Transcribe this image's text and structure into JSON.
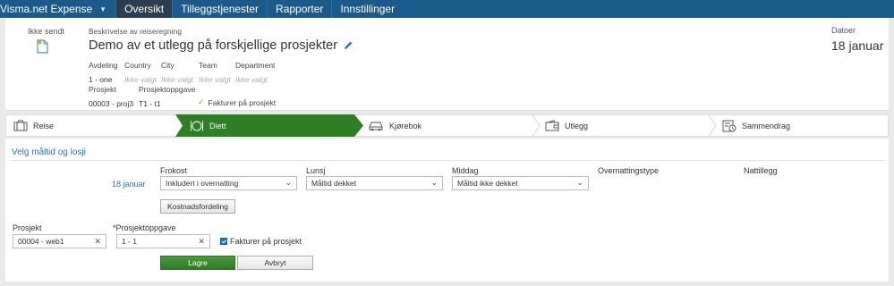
{
  "nav": {
    "brand": "Visma.net Expense",
    "tabs": [
      "Oversikt",
      "Tilleggstjenester",
      "Rapporter",
      "Innstillinger"
    ]
  },
  "header": {
    "status": "Ikke sendt",
    "description_label": "Beskrivelse av reiseregning",
    "title": "Demo av et utlegg på forskjellige prosjekter",
    "fields": {
      "avdeling": {
        "label": "Avdeling",
        "value": "1 - one"
      },
      "country": {
        "label": "Country",
        "value": "Ikke valgt"
      },
      "city": {
        "label": "City",
        "value": "Ikke valgt"
      },
      "team": {
        "label": "Team",
        "value": "Ikke valgt"
      },
      "department": {
        "label": "Department",
        "value": "Ikke valgt"
      },
      "prosjekt": {
        "label": "Prosjekt",
        "value": "00003 - proj3"
      },
      "prosjektoppgave": {
        "label": "Prosjektoppgave",
        "value": "T1 - t1"
      }
    },
    "fakturer": "Fakturer på prosjekt",
    "date_label": "Datoer",
    "date_value": "18 januar"
  },
  "steps": [
    "Reise",
    "Diett",
    "Kjørebok",
    "Utlegg",
    "Sammendrag"
  ],
  "meals": {
    "section_title": "Velg måltid og losji",
    "columns": [
      "Frokost",
      "Lunsj",
      "Middag",
      "Overnattingstype",
      "Nattillegg"
    ],
    "row_date": "18 januar",
    "frokost": "Inkludert i overnatting",
    "lunsj": "Måltid dekket",
    "middag": "Måltid ikke dekket",
    "kostnad_button": "Kostnadsfordeling"
  },
  "project": {
    "prosjekt_label": "Prosjekt",
    "prosjekt_value": "00004 - web1",
    "oppgave_label": "*Prosjektoppgave",
    "oppgave_value": "1 - 1",
    "fakturer_label": "Fakturer på prosjekt"
  },
  "actions": {
    "save": "Lagre",
    "cancel": "Avbryt"
  },
  "colors": {
    "nav": "#1b5a8a",
    "active_step": "#2f7d24",
    "accent_link": "#2e73ad",
    "save_button": "#3b8a31"
  }
}
